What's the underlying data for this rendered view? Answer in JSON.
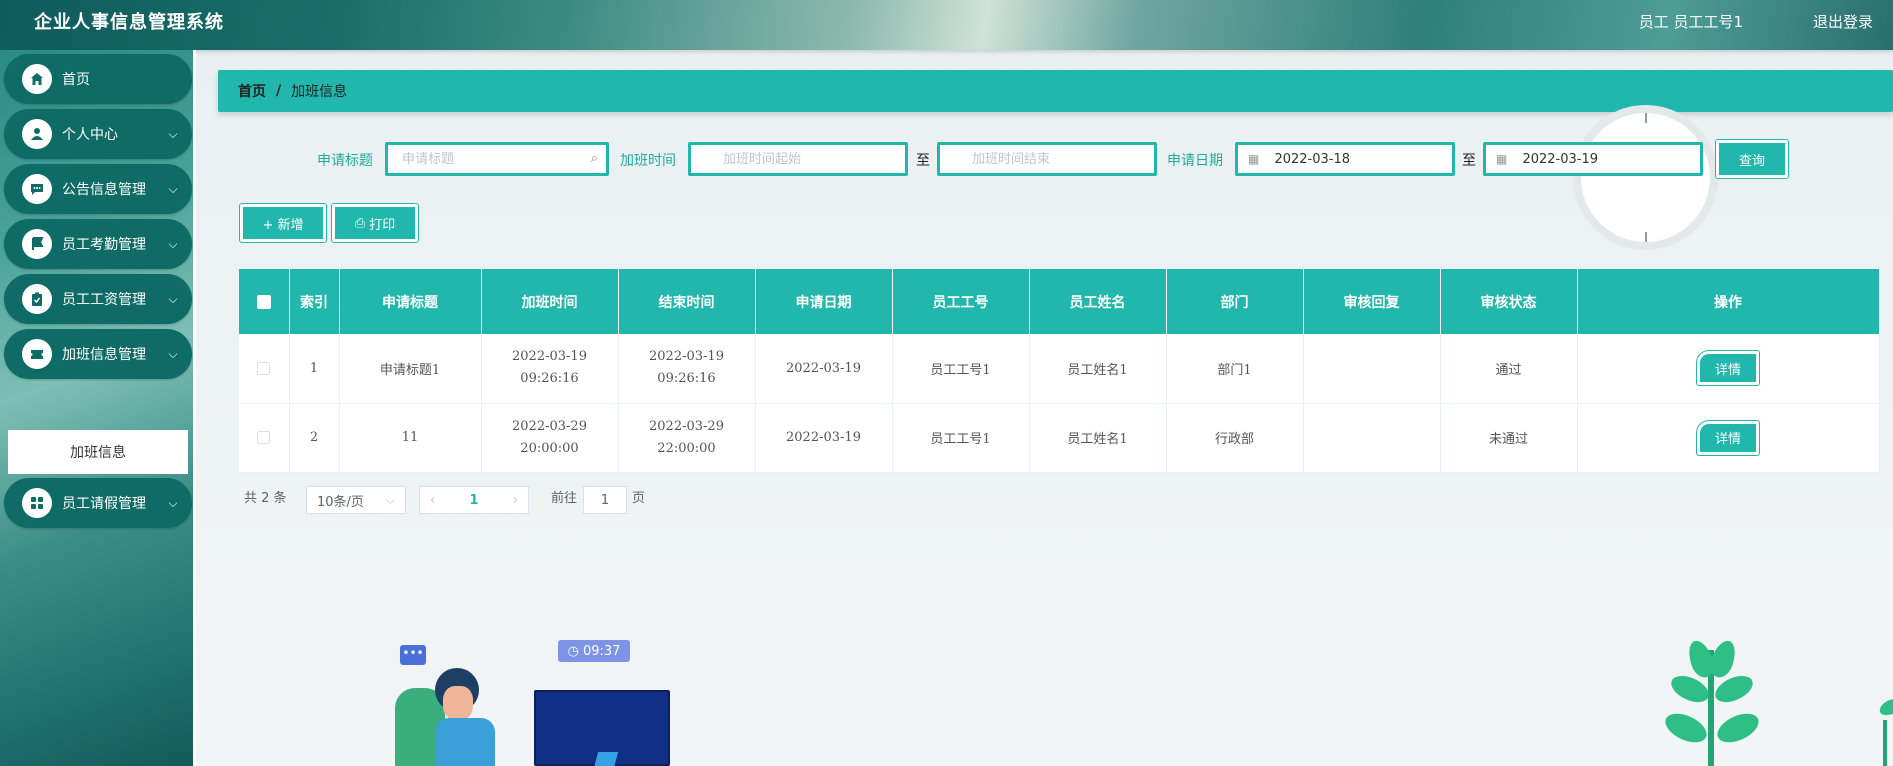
{
  "header": {
    "title": "企业人事信息管理系统",
    "user": "员工  员工工号1",
    "logout": "退出登录"
  },
  "sidebar": {
    "items": [
      {
        "label": "首页",
        "icon": "home-icon"
      },
      {
        "label": "个人中心",
        "icon": "user-icon"
      },
      {
        "label": "公告信息管理",
        "icon": "chat-icon"
      },
      {
        "label": "员工考勤管理",
        "icon": "flag-icon"
      },
      {
        "label": "员工工资管理",
        "icon": "clipboard-icon"
      },
      {
        "label": "加班信息管理",
        "icon": "ticket-icon"
      },
      {
        "label": "员工请假管理",
        "icon": "grid-icon"
      }
    ],
    "submenu": "加班信息"
  },
  "breadcrumb": {
    "home": "首页",
    "sep": "/",
    "current": "加班信息"
  },
  "search": {
    "title_label": "申请标题",
    "title_placeholder": "申请标题",
    "ot_label": "加班时间",
    "ot_start_placeholder": "加班时间起始",
    "to": "至",
    "ot_end_placeholder": "加班时间结束",
    "date_label": "申请日期",
    "date_start": "2022-03-18",
    "date_end": "2022-03-19",
    "query_label": "查询"
  },
  "toolbar": {
    "add_label": "+ 新增",
    "print_label": "打印"
  },
  "table": {
    "headers": [
      "索引",
      "申请标题",
      "加班时间",
      "结束时间",
      "申请日期",
      "员工工号",
      "员工姓名",
      "部门",
      "审核回复",
      "审核状态",
      "操作"
    ],
    "rows": [
      [
        "1",
        "申请标题1",
        "2022-03-19 09:26:16",
        "2022-03-19 09:26:16",
        "2022-03-19",
        "员工工号1",
        "员工姓名1",
        "部门1",
        "",
        "通过"
      ],
      [
        "2",
        "11",
        "2022-03-29 20:00:00",
        "2022-03-29 22:00:00",
        "2022-03-19",
        "员工工号1",
        "员工姓名1",
        "行政部",
        "",
        "未通过"
      ]
    ],
    "detail_label": "详情"
  },
  "pagination": {
    "total": "共 2 条",
    "page_size": "10条/页",
    "current": "1",
    "goto_label": "前往",
    "goto_value": "1",
    "page_suffix": "页"
  },
  "illustration": {
    "time": "09:37"
  },
  "colors": {
    "accent": "#22b7ac",
    "sidebar_item": "#0f6b66"
  }
}
